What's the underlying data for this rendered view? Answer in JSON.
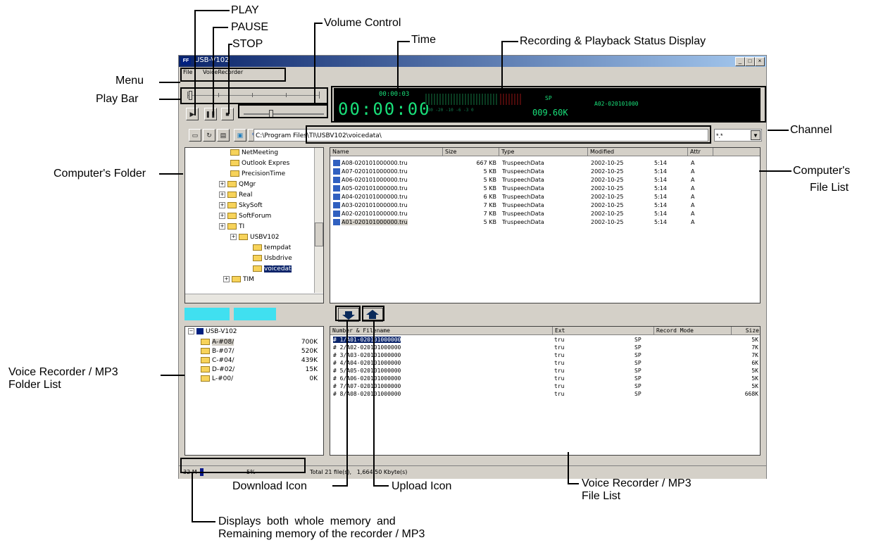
{
  "annotations": {
    "play": "PLAY",
    "pause": "PAUSE",
    "stop": "STOP",
    "volume_control": "Volume Control",
    "time": "Time",
    "status_display": "Recording & Playback Status Display",
    "menu": "Menu",
    "play_bar": "Play Bar",
    "channel": "Channel",
    "computers_folder": "Computer's Folder",
    "computers_file_list_1": "Computer's",
    "computers_file_list_2": "File List",
    "vr_folder_list_1": "Voice Recorder / MP3",
    "vr_folder_list_2": "Folder List",
    "download_icon": "Download Icon",
    "upload_icon": "Upload Icon",
    "vr_file_list_1": "Voice Recorder / MP3",
    "vr_file_list_2": "File List",
    "memory_1": "Displays both whole memory and",
    "memory_2": "Remaining memory of the recorder / MP3"
  },
  "window": {
    "title": "USB-V102",
    "menu": [
      "File",
      "VoiceRecorder"
    ],
    "status_display": {
      "small_time": "00:00:03",
      "big_time": "00:00:00",
      "mode": "SP",
      "size": "009.60K",
      "file_id": "A02-020101000"
    },
    "path": "C:\\Program Files\\TI\\USBV102\\voicedata\\",
    "channel_value": "*.*",
    "computer_folders": [
      {
        "label": "NetMeeting"
      },
      {
        "label": "Outlook Expres"
      },
      {
        "label": "PrecisionTime"
      },
      {
        "label": "QMgr"
      },
      {
        "label": "Real"
      },
      {
        "label": "SkySoft"
      },
      {
        "label": "SoftForum"
      },
      {
        "label": "TI"
      },
      {
        "label": "USBV102"
      },
      {
        "label": "tempdat"
      },
      {
        "label": "Usbdrive"
      },
      {
        "label": "voicedat"
      },
      {
        "label": "TIM"
      }
    ],
    "file_list_headers": [
      "Name",
      "Size",
      "Type",
      "Modified",
      "Attr"
    ],
    "files": [
      {
        "name": "A08-020101000000.tru",
        "size": "667 KB",
        "type": "TruspeechData",
        "date": "2002-10-25",
        "time": "5:14",
        "attr": "A"
      },
      {
        "name": "A07-020101000000.tru",
        "size": "5 KB",
        "type": "TruspeechData",
        "date": "2002-10-25",
        "time": "5:14",
        "attr": "A"
      },
      {
        "name": "A06-020101000000.tru",
        "size": "5 KB",
        "type": "TruspeechData",
        "date": "2002-10-25",
        "time": "5:14",
        "attr": "A"
      },
      {
        "name": "A05-020101000000.tru",
        "size": "5 KB",
        "type": "TruspeechData",
        "date": "2002-10-25",
        "time": "5:14",
        "attr": "A"
      },
      {
        "name": "A04-020101000000.tru",
        "size": "6 KB",
        "type": "TruspeechData",
        "date": "2002-10-25",
        "time": "5:14",
        "attr": "A"
      },
      {
        "name": "A03-020101000000.tru",
        "size": "7 KB",
        "type": "TruspeechData",
        "date": "2002-10-25",
        "time": "5:14",
        "attr": "A"
      },
      {
        "name": "A02-020101000000.tru",
        "size": "7 KB",
        "type": "TruspeechData",
        "date": "2002-10-25",
        "time": "5:14",
        "attr": "A"
      },
      {
        "name": "A01-020101000000.tru",
        "size": "5 KB",
        "type": "TruspeechData",
        "date": "2002-10-25",
        "time": "5:14",
        "attr": "A"
      }
    ],
    "device_root": "USB-V102",
    "device_folders": [
      {
        "label": "A-#08/",
        "size": "700K"
      },
      {
        "label": "B-#07/",
        "size": "520K"
      },
      {
        "label": "C-#04/",
        "size": "439K"
      },
      {
        "label": "D-#02/",
        "size": "15K"
      },
      {
        "label": "L-#00/",
        "size": "0K"
      }
    ],
    "device_headers": [
      "Number & Filename",
      "Ext",
      "Record Mode",
      "Size"
    ],
    "device_files": [
      {
        "name": "# 1/A01-020101000000",
        "ext": "tru",
        "mode": "SP",
        "size": "5K"
      },
      {
        "name": "# 2/A02-020101000000",
        "ext": "tru",
        "mode": "SP",
        "size": "7K"
      },
      {
        "name": "# 3/A03-020101000000",
        "ext": "tru",
        "mode": "SP",
        "size": "7K"
      },
      {
        "name": "# 4/A04-020101000000",
        "ext": "tru",
        "mode": "SP",
        "size": "6K"
      },
      {
        "name": "# 5/A05-020101000000",
        "ext": "tru",
        "mode": "SP",
        "size": "5K"
      },
      {
        "name": "# 6/A06-020101000000",
        "ext": "tru",
        "mode": "SP",
        "size": "5K"
      },
      {
        "name": "# 7/A07-020101000000",
        "ext": "tru",
        "mode": "SP",
        "size": "5K"
      },
      {
        "name": "# 8/A08-020101000000",
        "ext": "tru",
        "mode": "SP",
        "size": "668K"
      }
    ],
    "statusbar": {
      "memory": "32 M",
      "percent": "5%",
      "total": "Total 21 file(s),   1,664.50 Kbyte(s)"
    }
  }
}
